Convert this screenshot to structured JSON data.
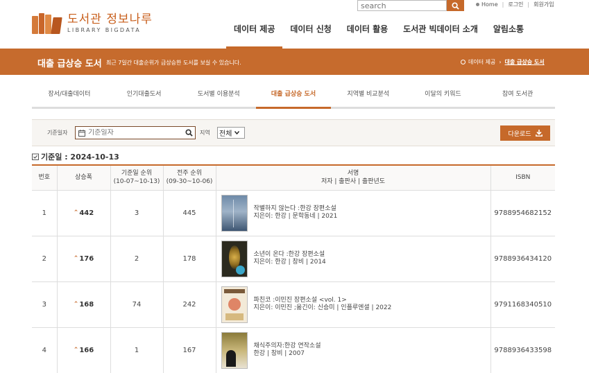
{
  "header": {
    "logo_ko": "도서관 정보나루",
    "logo_en": "LIBRARY BIGDATA",
    "search_placeholder": "search",
    "top_links": [
      "Home",
      "로그인",
      "회원가입"
    ],
    "gnb": [
      "데이터 제공",
      "데이터 신청",
      "데이터 활용",
      "도서관 빅데이터 소개",
      "알림소통"
    ]
  },
  "banner": {
    "title": "대출 급상승 도서",
    "desc": "최근 7일간 대출순위가 급상승한 도서를 보실 수 있습니다.",
    "crumb_parent": "데이터 제공",
    "crumb_current": "대출 급상승 도서"
  },
  "subtabs": [
    "장서/대출데이터",
    "인기대출도서",
    "도서별 이용분석",
    "대출 급상승 도서",
    "지역별 비교분석",
    "이달의 키워드",
    "참여 도서관"
  ],
  "filter": {
    "date_label": "기준일자",
    "date_placeholder": "기준일자",
    "region_label": "지역",
    "region_value": "전체",
    "download_label": "다운로드"
  },
  "date_heading": "기준일 : 2024-10-13",
  "table": {
    "headers": {
      "no": "번호",
      "rise": "상승폭",
      "cur_rank_1": "기준일 순위",
      "cur_rank_2": "(10-07~10-13)",
      "prev_rank_1": "전주 순위",
      "prev_rank_2": "(09-30~10-06)",
      "title_1": "서명",
      "title_2": "저자 | 출판사 | 출판년도",
      "isbn": "ISBN"
    },
    "rows": [
      {
        "no": "1",
        "rise": "442",
        "cur": "3",
        "prev": "445",
        "title": "작별하지 않는다 :한강 장편소설",
        "meta": "지은이: 한강 | 문학동네 | 2021",
        "isbn": "9788954682152"
      },
      {
        "no": "2",
        "rise": "176",
        "cur": "2",
        "prev": "178",
        "title": "소년이 온다 :한강 장편소설",
        "meta": "지은이: 한강 | 창비 | 2014",
        "isbn": "9788936434120"
      },
      {
        "no": "3",
        "rise": "168",
        "cur": "74",
        "prev": "242",
        "title": "파친코 :이민진 장편소설 <vol. 1>",
        "meta": "지은이: 이민진 ;옮긴이: 신승미 | 인플루엔셜 | 2022",
        "isbn": "9791168340510"
      },
      {
        "no": "4",
        "rise": "166",
        "cur": "1",
        "prev": "167",
        "title": "채식주의자:한강 연작소설",
        "meta": "한강 | 창비 | 2007",
        "isbn": "9788936433598"
      }
    ]
  },
  "colors": {
    "accent": "#c6692a",
    "banner": "#c66b2d"
  }
}
